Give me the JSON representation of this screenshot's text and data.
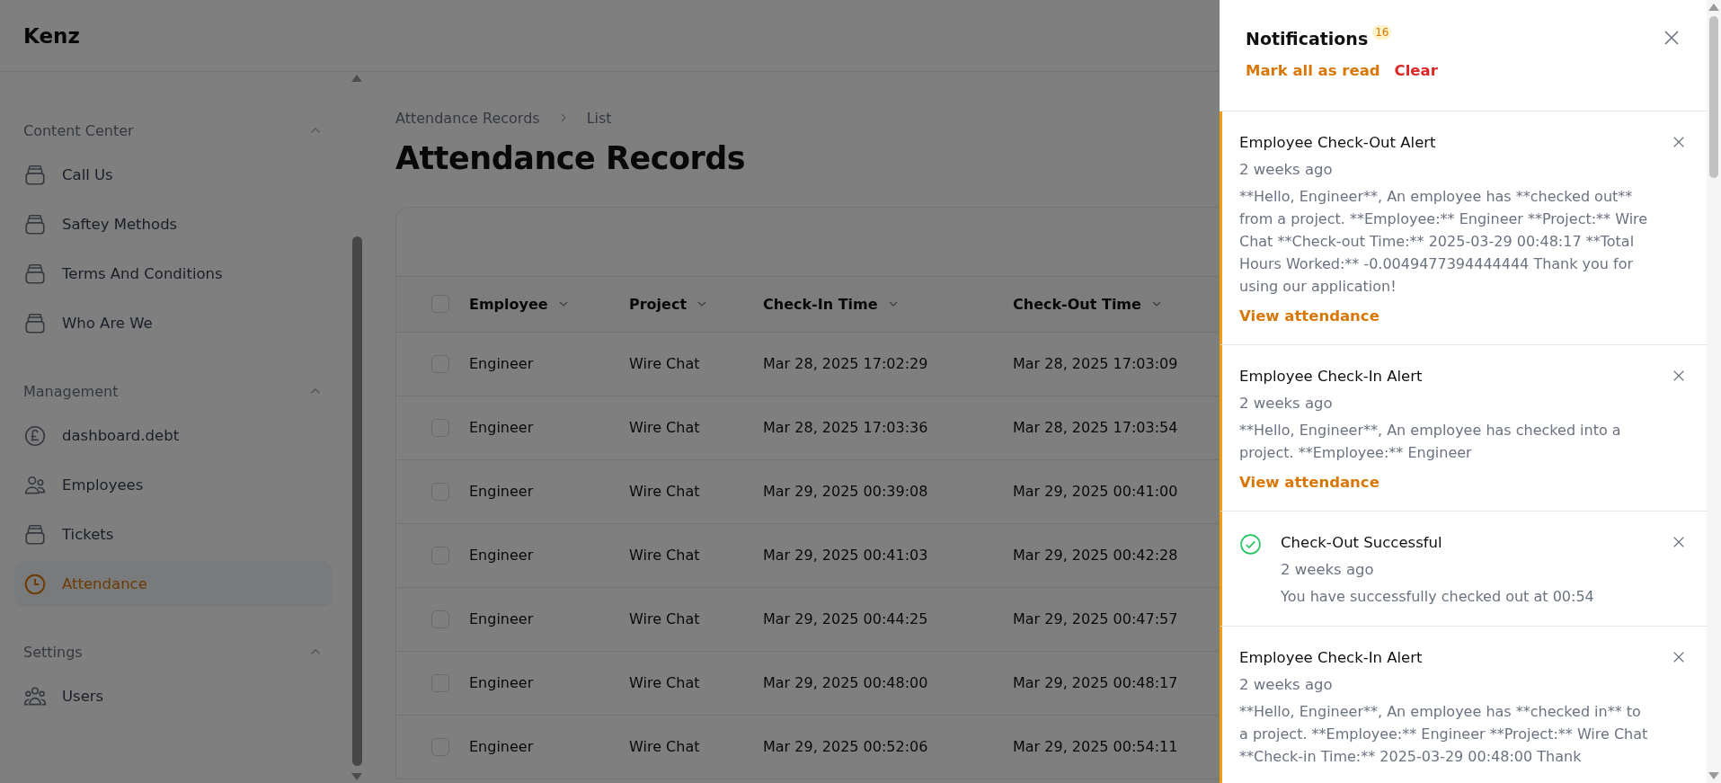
{
  "app": {
    "title": "Kenz"
  },
  "sidebar": {
    "groups": [
      {
        "label": "Content Center",
        "expanded": true,
        "items": [
          {
            "label": "Call Us",
            "kind": "tray",
            "selected": false
          },
          {
            "label": "Saftey Methods",
            "kind": "tray",
            "selected": false
          },
          {
            "label": "Terms And Conditions",
            "kind": "tray",
            "selected": false
          },
          {
            "label": "Who Are We",
            "kind": "tray",
            "selected": false
          }
        ]
      },
      {
        "label": "Management",
        "expanded": true,
        "items": [
          {
            "label": "dashboard.debt",
            "kind": "pound",
            "selected": false
          },
          {
            "label": "Employees",
            "kind": "people",
            "selected": false
          },
          {
            "label": "Tickets",
            "kind": "tray",
            "selected": false
          },
          {
            "label": "Attendance",
            "kind": "clock",
            "selected": true
          }
        ]
      },
      {
        "label": "Settings",
        "expanded": true,
        "items": [
          {
            "label": "Users",
            "kind": "group",
            "selected": false
          }
        ]
      }
    ]
  },
  "breadcrumb": [
    "Attendance Records",
    "List"
  ],
  "page_title": "Attendance Records",
  "table": {
    "select_all_checked": false,
    "columns": [
      "Employee",
      "Project",
      "Check-In Time",
      "Check-Out Time"
    ],
    "rows": [
      {
        "checked": false,
        "cells": [
          "Engineer",
          "Wire Chat",
          "Mar 28, 2025 17:02:29",
          "Mar 28, 2025 17:03:09"
        ]
      },
      {
        "checked": false,
        "cells": [
          "Engineer",
          "Wire Chat",
          "Mar 28, 2025 17:03:36",
          "Mar 28, 2025 17:03:54"
        ]
      },
      {
        "checked": false,
        "cells": [
          "Engineer",
          "Wire Chat",
          "Mar 29, 2025 00:39:08",
          "Mar 29, 2025 00:41:00"
        ]
      },
      {
        "checked": false,
        "cells": [
          "Engineer",
          "Wire Chat",
          "Mar 29, 2025 00:41:03",
          "Mar 29, 2025 00:42:28"
        ]
      },
      {
        "checked": false,
        "cells": [
          "Engineer",
          "Wire Chat",
          "Mar 29, 2025 00:44:25",
          "Mar 29, 2025 00:47:57"
        ]
      },
      {
        "checked": false,
        "cells": [
          "Engineer",
          "Wire Chat",
          "Mar 29, 2025 00:48:00",
          "Mar 29, 2025 00:48:17"
        ]
      },
      {
        "checked": false,
        "cells": [
          "Engineer",
          "Wire Chat",
          "Mar 29, 2025 00:52:06",
          "Mar 29, 2025 00:54:11"
        ]
      }
    ]
  },
  "notifications": {
    "title": "Notifications",
    "count": "16",
    "actions": [
      {
        "label": "Mark all as read",
        "kind": "primary"
      },
      {
        "label": "Clear",
        "kind": "danger"
      }
    ],
    "items": [
      {
        "kind": "alert",
        "unread": true,
        "title": "Employee Check-Out Alert",
        "time": "2 weeks ago",
        "body": "**Hello, Engineer**, An employee has **checked out** from a project. **Employee:** Engineer **Project:** Wire Chat **Check-out Time:** 2025-03-29 00:48:17 **Total Hours Worked:** -0.0049477394444444 Thank you for using our application!",
        "link": "View attendance"
      },
      {
        "kind": "alert",
        "unread": true,
        "title": "Employee Check-In Alert",
        "time": "2 weeks ago",
        "body": "**Hello, Engineer**, An employee has checked into a project. **Employee:** Engineer",
        "link": "View attendance"
      },
      {
        "kind": "success",
        "unread": true,
        "title": "Check-Out Successful",
        "time": "2 weeks ago",
        "body": "You have successfully checked out at 00:54"
      },
      {
        "kind": "alert",
        "unread": true,
        "title": "Employee Check-In Alert",
        "time": "2 weeks ago",
        "body": "**Hello, Engineer**, An employee has **checked in** to a project. **Employee:** Engineer **Project:** Wire Chat **Check-in Time:** 2025-03-29 00:48:00 Thank"
      }
    ]
  }
}
